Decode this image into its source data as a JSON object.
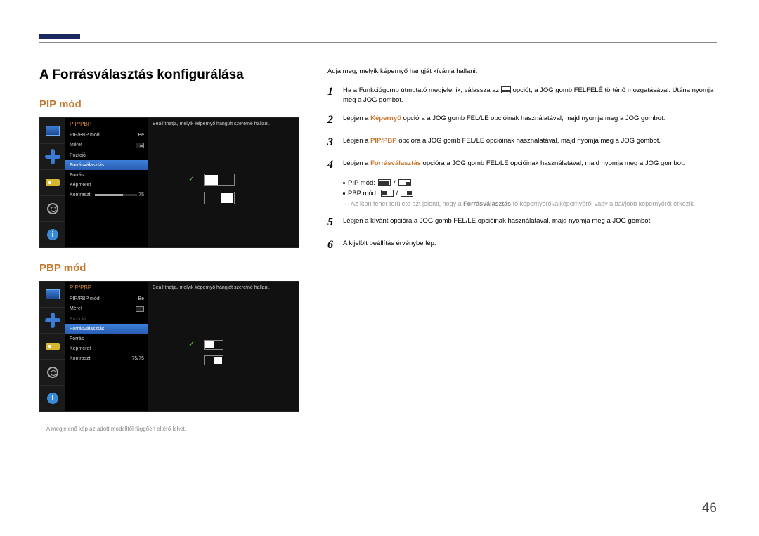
{
  "title": "A Forrásválasztás konfigurálása",
  "pip_heading": "PIP mód",
  "pbp_heading": "PBP mód",
  "osd_title": "PIP/PBP",
  "menu": {
    "mode": "PIP/PBP mód",
    "mode_val": "Be",
    "size": "Méret",
    "pos": "Pozíció",
    "source_sel": "Forrásválasztás",
    "source": "Forrás",
    "img_size": "Képméret",
    "contrast": "Kontraszt",
    "contrast_val_pip": "75",
    "contrast_val_pbp": "75/75"
  },
  "tip": "Beállíthatja, melyik képernyő hangját szeretné hallani.",
  "intro": "Adja meg, melyik képernyő hangját kívánja hallani.",
  "steps": {
    "s1a": "Ha a Funkciógomb útmutató megjelenik, válassza az ",
    "s1b": " opciót, a JOG gomb FELFELÉ történő mozgatásával. Utána nyomja meg a JOG gombot.",
    "s2a": "Lépjen a ",
    "s2_em": "Képernyő",
    "s2b": " opcióra a JOG gomb FEL/LE opcióinak használatával, majd nyomja meg a JOG gombot.",
    "s3_em": "PIP/PBP",
    "s3b": " opcióra a JOG gomb FEL/LE opcióinak használatával, majd nyomja meg a JOG gombot.",
    "s4_em": "Forrásválasztás",
    "s4b": " opcióra a JOG gomb FEL/LE opcióinak használatával, majd nyomja meg a JOG gombot.",
    "pip_label": "PIP mód:",
    "pbp_label": "PBP mód:",
    "note_a": "― Az ikon fehér területe azt jelenti, hogy a ",
    "note_em": "Forrásválasztás",
    "note_b": " fő képernyőről/alképernyőről vagy a bal/jobb képernyőről érkezik.",
    "s5": "Lépjen a kívánt opcióra a JOG gomb FEL/LE opcióinak használatával, majd nyomja meg a JOG gombot.",
    "s6": "A kijelölt beállítás érvénybe lép."
  },
  "footnote": "― A megjelenő kép az adott modelltől függően eltérő lehet.",
  "page_num": "46"
}
